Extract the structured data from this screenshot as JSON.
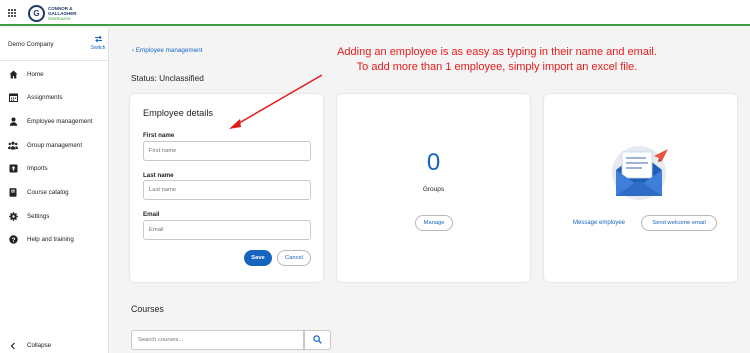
{
  "header": {
    "logo_mark": "G",
    "logo_line1": "CONNOR &",
    "logo_line2": "GALLAGHER",
    "logo_line3": "OneSource",
    "accent": "#3e9d45",
    "apps_icon": "apps-grid-icon"
  },
  "sidebar": {
    "company": "Demo Company",
    "switch_label": "Switch",
    "switch_icon": "switch-arrows-icon",
    "items": [
      {
        "label": "Home",
        "icon": "home-icon"
      },
      {
        "label": "Assignments",
        "icon": "calendar-icon"
      },
      {
        "label": "Employee management",
        "icon": "person-icon"
      },
      {
        "label": "Group management",
        "icon": "group-icon"
      },
      {
        "label": "Imports",
        "icon": "upload-icon"
      },
      {
        "label": "Course catalog",
        "icon": "book-icon"
      },
      {
        "label": "Settings",
        "icon": "gear-icon"
      },
      {
        "label": "Help and training",
        "icon": "help-icon"
      }
    ],
    "collapse_label": "Collapse",
    "collapse_icon": "chevron-left-icon"
  },
  "main": {
    "breadcrumb": "Employee management",
    "status": "Status:  Unclassified",
    "employee_card": {
      "title": "Employee details",
      "first_name_label": "First name",
      "first_name_placeholder": "First name",
      "last_name_label": "Last name",
      "last_name_placeholder": "Last name",
      "email_label": "Email",
      "email_placeholder": "Email",
      "save_label": "Save",
      "cancel_label": "Cancel"
    },
    "groups_card": {
      "count": "0",
      "label": "Groups",
      "manage_label": "Manage"
    },
    "message_card": {
      "illustration": "envelope-illustration-icon",
      "message_label": "Message employee",
      "welcome_label": "Send welcome email"
    },
    "courses": {
      "title": "Courses",
      "search_placeholder": "Search courses...",
      "search_icon": "search-icon"
    }
  },
  "annotation": {
    "line1": "Adding an employee is as easy as typing in their name and email.",
    "line2": "To add more than 1 employee, simply import an excel file.",
    "color": "#e41b1b"
  },
  "colors": {
    "primary": "#1565c0",
    "background": "#f4f4f4"
  }
}
